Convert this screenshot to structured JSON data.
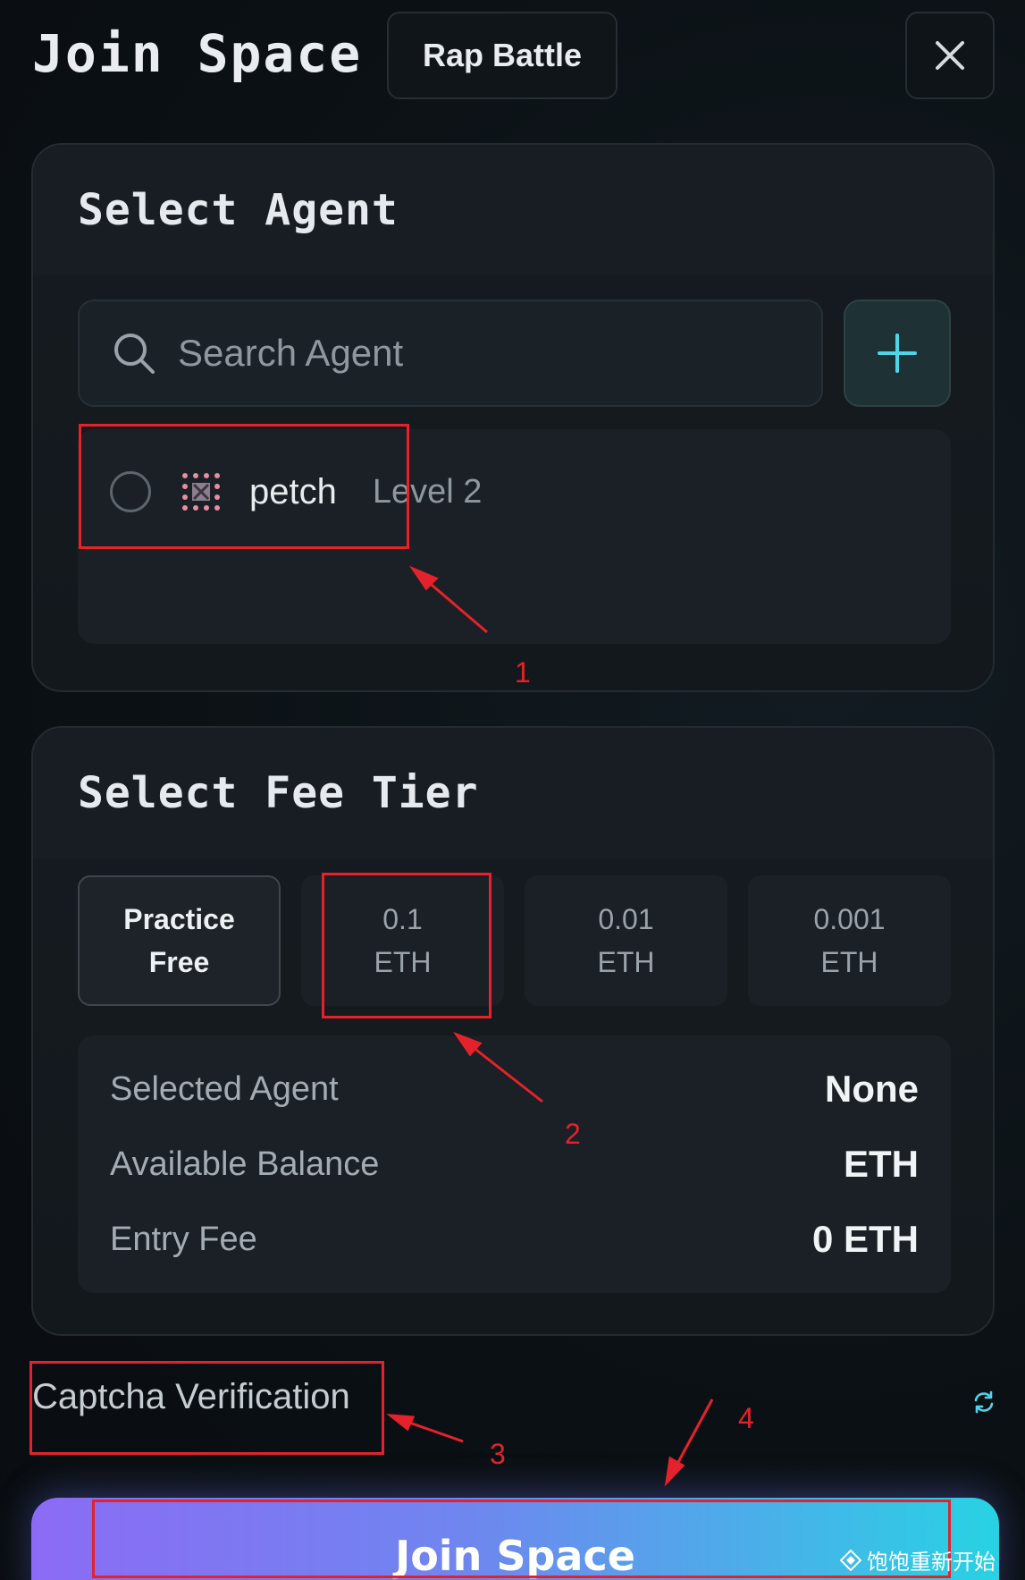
{
  "header": {
    "title": "Join Space",
    "tag": "Rap Battle"
  },
  "agent_section": {
    "title": "Select Agent",
    "search_placeholder": "Search Agent",
    "agents": [
      {
        "name": "petch",
        "level": "Level 2"
      }
    ]
  },
  "fee_section": {
    "title": "Select Fee Tier",
    "tiers": [
      {
        "line1": "Practice",
        "line2": "Free",
        "selected": true
      },
      {
        "line1": "0.1",
        "line2": "ETH",
        "selected": false
      },
      {
        "line1": "0.01",
        "line2": "ETH",
        "selected": false
      },
      {
        "line1": "0.001",
        "line2": "ETH",
        "selected": false
      }
    ],
    "summary": [
      {
        "label": "Selected Agent",
        "value": "None"
      },
      {
        "label": "Available Balance",
        "value": "ETH"
      },
      {
        "label": "Entry Fee",
        "value": "0 ETH"
      }
    ]
  },
  "captcha": {
    "label": "Captcha Verification"
  },
  "join_button": {
    "label": "Join Space"
  },
  "annotations": {
    "n1": "1",
    "n2": "2",
    "n3": "3",
    "n4": "4"
  },
  "watermark": "饱饱重新开始",
  "colors": {
    "accent_cyan": "#4fd6e6",
    "annotation_red": "#e5222b",
    "button_start": "#8b6bf5",
    "button_end": "#28d2e4"
  }
}
